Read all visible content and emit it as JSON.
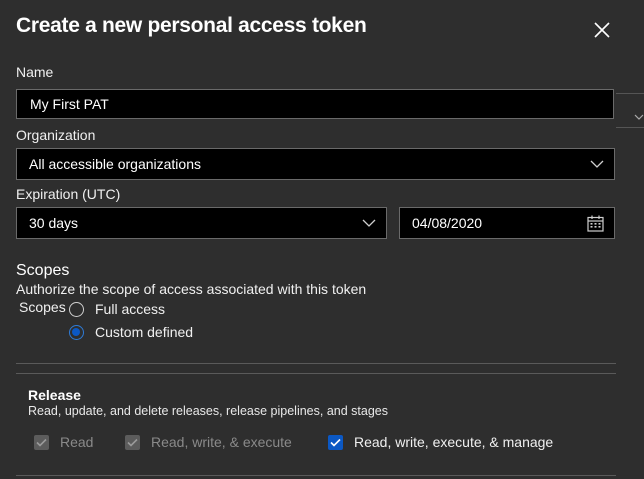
{
  "dialog": {
    "title": "Create a new personal access token"
  },
  "fields": {
    "name": {
      "label": "Name",
      "value": "My First PAT"
    },
    "organization": {
      "label": "Organization",
      "value": "All accessible organizations"
    },
    "expiration": {
      "label": "Expiration (UTC)",
      "duration": "30 days",
      "date": "04/08/2020"
    }
  },
  "scopes": {
    "heading": "Scopes",
    "description": "Authorize the scope of access associated with this token",
    "sublabel": "Scopes",
    "options": [
      {
        "label": "Full access",
        "selected": false
      },
      {
        "label": "Custom defined",
        "selected": true
      }
    ]
  },
  "release": {
    "title": "Release",
    "description": "Read, update, and delete releases, release pipelines, and stages",
    "permissions": [
      {
        "label": "Read",
        "checked": true,
        "enabled": false
      },
      {
        "label": "Read, write, & execute",
        "checked": true,
        "enabled": false
      },
      {
        "label": "Read, write, execute, & manage",
        "checked": true,
        "enabled": true
      }
    ]
  },
  "icons": {
    "close": "close-icon",
    "dropdown": "chevron-down-icon",
    "calendar": "calendar-icon",
    "check": "checkmark-icon"
  },
  "colors": {
    "background": "#2e2e2e",
    "input_background": "#000000",
    "accent": "#0b58c4",
    "disabled": "#5c5c5c"
  }
}
